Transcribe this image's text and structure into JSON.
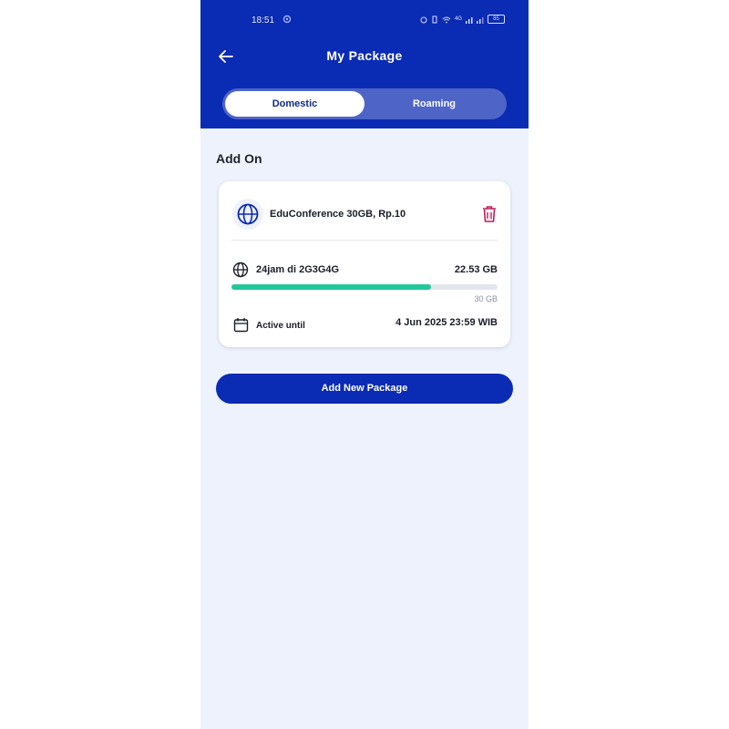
{
  "status_bar": {
    "time": "18:51",
    "battery": "85",
    "network": "4G"
  },
  "header": {
    "title": "My Package",
    "tabs": [
      {
        "label": "Domestic",
        "active": true
      },
      {
        "label": "Roaming",
        "active": false
      }
    ]
  },
  "section": {
    "title": "Add On"
  },
  "package": {
    "name": "EduConference 30GB, Rp.10",
    "quota_name": "24jam di 2G3G4G",
    "remaining": "22.53 GB",
    "total": "30 GB",
    "used_fraction": 0.75,
    "active_label": "Active until",
    "active_date": "4 Jun 2025 23:59 WIB"
  },
  "actions": {
    "add_new_label": "Add New Package"
  },
  "colors": {
    "brand": "#0a2bb3",
    "progress": "#22c79a",
    "delete": "#c2185b",
    "background": "#eef2fc"
  },
  "icons": {
    "back": "arrow-left-icon",
    "package": "globe-icon",
    "delete": "trash-icon",
    "quota": "globe-icon",
    "date": "calendar-icon"
  }
}
